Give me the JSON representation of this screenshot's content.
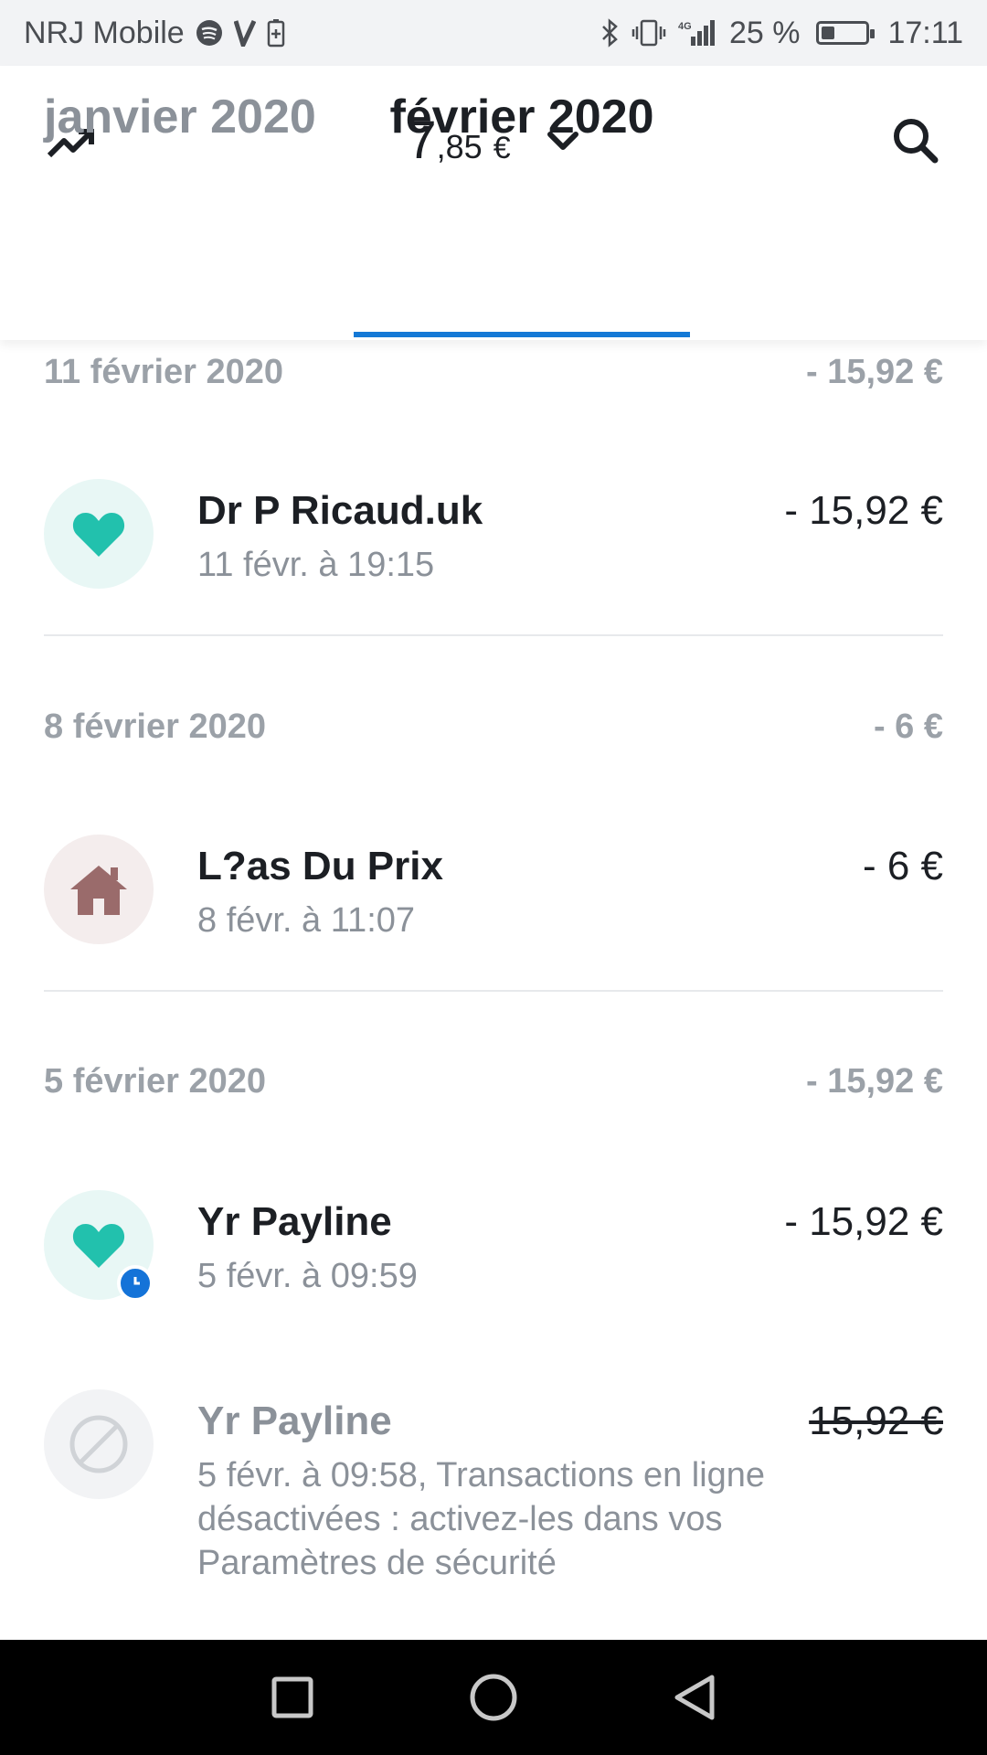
{
  "status_bar": {
    "carrier": "NRJ Mobile",
    "network": "4G",
    "battery": "25 %",
    "time": "17:11"
  },
  "header": {
    "balance_int": "7",
    "balance_dec": ",85",
    "currency": "€",
    "icons": [
      "trending-up-icon",
      "chevron-down-icon",
      "search-icon"
    ]
  },
  "tabs": [
    {
      "label": "janvier 2020",
      "selected": false
    },
    {
      "label": "février 2020",
      "selected": true
    }
  ],
  "accent_color": "#1479d6",
  "days": [
    {
      "date": "11 février 2020",
      "total": "- 15,92 €",
      "transactions": [
        {
          "name": "Dr P Ricaud.uk",
          "subtitle": "11 févr. à 19:15",
          "amount": "- 15,92 €",
          "icon": "heart-icon",
          "icon_color": "#22c1ad",
          "bg": "#e8f7f5"
        }
      ]
    },
    {
      "date": "8 février 2020",
      "total": "- 6 €",
      "transactions": [
        {
          "name": "L?as Du Prix",
          "subtitle": "8 févr. à 11:07",
          "amount": "- 6 €",
          "icon": "house-icon",
          "icon_color": "#9a6b6b",
          "bg": "#f4eded"
        }
      ]
    },
    {
      "date": "5 février 2020",
      "total": "- 15,92 €",
      "transactions": [
        {
          "name": "Yr Payline",
          "subtitle": "5 févr. à 09:59",
          "amount": "- 15,92 €",
          "icon": "heart-icon",
          "icon_color": "#22c1ad",
          "bg": "#e8f7f5",
          "badge": "clock-icon"
        },
        {
          "name": "Yr Payline",
          "subtitle": "5 févr. à 09:58, Transactions en ligne désactivées : activez-les dans vos Paramètres de sécurité",
          "amount": "15,92 €",
          "icon": "blocked-icon",
          "icon_color": "#d0d3d7",
          "bg": "#f2f3f5",
          "declined": true
        }
      ]
    }
  ]
}
